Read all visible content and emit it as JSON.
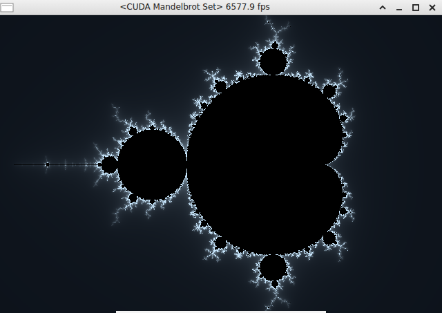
{
  "window": {
    "title": "<CUDA Mandelbrot Set> 6577.9 fps"
  }
}
